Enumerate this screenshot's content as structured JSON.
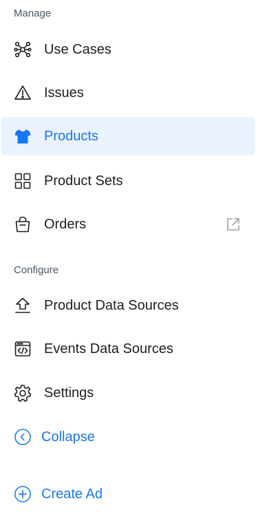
{
  "sections": {
    "manage": "Manage",
    "configure": "Configure"
  },
  "items": {
    "use_cases": "Use Cases",
    "issues": "Issues",
    "products": "Products",
    "product_sets": "Product Sets",
    "orders": "Orders",
    "product_data_sources": "Product Data Sources",
    "events_data_sources": "Events Data Sources",
    "settings": "Settings"
  },
  "links": {
    "collapse": "Collapse",
    "create_ad": "Create Ad"
  },
  "colors": {
    "accent": "#1877f2",
    "active_bg": "#eaf3fd",
    "text": "#1c1e21",
    "muted": "#4b5563"
  },
  "icons": {
    "use_cases": "network-nodes-icon",
    "issues": "warning-triangle-icon",
    "products": "tshirt-icon",
    "product_sets": "grid-icon",
    "orders": "shopping-bag-icon",
    "orders_external": "external-link-icon",
    "product_data_sources": "upload-arrow-icon",
    "events_data_sources": "code-window-icon",
    "settings": "gear-icon",
    "collapse": "chevron-left-circle-icon",
    "create_ad": "plus-circle-icon"
  }
}
